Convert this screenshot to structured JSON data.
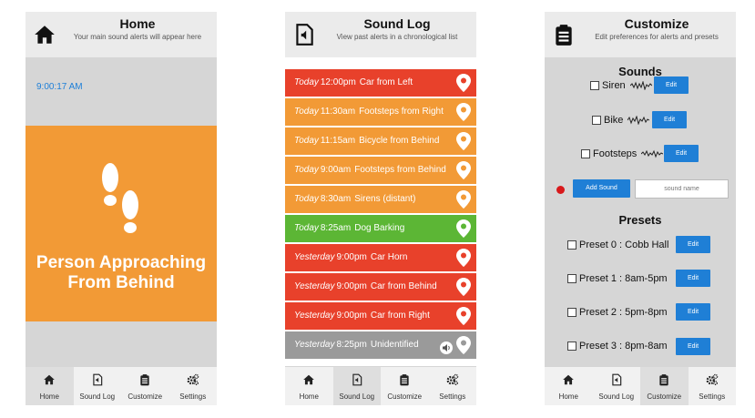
{
  "home": {
    "title": "Home",
    "subtitle": "Your main sound alerts will appear here",
    "clock": "9:00:17 AM",
    "alert_text": "Person Approaching From Behind",
    "alert_color": "#f29a36"
  },
  "soundlog": {
    "title": "Sound Log",
    "subtitle": "View past alerts in a chronological list",
    "entries": [
      {
        "when": "Today",
        "time": "12:00pm",
        "label": "Car from Left",
        "color": "#e8412b"
      },
      {
        "when": "Today",
        "time": "11:30am",
        "label": "Footsteps from Right",
        "color": "#f29a36"
      },
      {
        "when": "Today",
        "time": "11:15am",
        "label": "Bicycle from Behind",
        "color": "#f29a36"
      },
      {
        "when": "Today",
        "time": "9:00am",
        "label": "Footsteps from Behind",
        "color": "#f29a36"
      },
      {
        "when": "Today",
        "time": "8:30am",
        "label": "Sirens (distant)",
        "color": "#f29a36"
      },
      {
        "when": "Today",
        "time": "8:25am",
        "label": "Dog Barking",
        "color": "#5cb635"
      },
      {
        "when": "Yesterday",
        "time": "9:00pm",
        "label": "Car Horn",
        "color": "#e8412b"
      },
      {
        "when": "Yesterday",
        "time": "9:00pm",
        "label": "Car from Behind",
        "color": "#e8412b"
      },
      {
        "when": "Yesterday",
        "time": "9:00pm",
        "label": "Car from Right",
        "color": "#e8412b"
      },
      {
        "when": "Yesterday",
        "time": "8:25pm",
        "label": "Unidentified",
        "color": "#9a9a9a"
      }
    ]
  },
  "customize": {
    "title": "Customize",
    "subtitle": "Edit preferences for alerts and presets",
    "sounds_heading": "Sounds",
    "sounds": [
      {
        "label": "Siren",
        "edit": "Edit"
      },
      {
        "label": "Bike",
        "edit": "Edit"
      },
      {
        "label": "Footsteps",
        "edit": "Edit"
      }
    ],
    "add_sound_label": "Add Sound",
    "sound_name_placeholder": "sound name",
    "presets_heading": "Presets",
    "presets": [
      {
        "label": "Preset 0 : Cobb Hall",
        "edit": "Edit"
      },
      {
        "label": "Preset 1 : 8am-5pm",
        "edit": "Edit"
      },
      {
        "label": "Preset 2 : 5pm-8pm",
        "edit": "Edit"
      },
      {
        "label": "Preset 3 : 8pm-8am",
        "edit": "Edit"
      }
    ]
  },
  "tabs": [
    {
      "label": "Home",
      "icon": "home-icon"
    },
    {
      "label": "Sound Log",
      "icon": "sound-log-icon"
    },
    {
      "label": "Customize",
      "icon": "clipboard-icon"
    },
    {
      "label": "Settings",
      "icon": "gears-icon"
    }
  ],
  "colors": {
    "accent": "#1f7fd6",
    "header_bg": "#ebebeb",
    "body_bg": "#d6d6d6"
  }
}
